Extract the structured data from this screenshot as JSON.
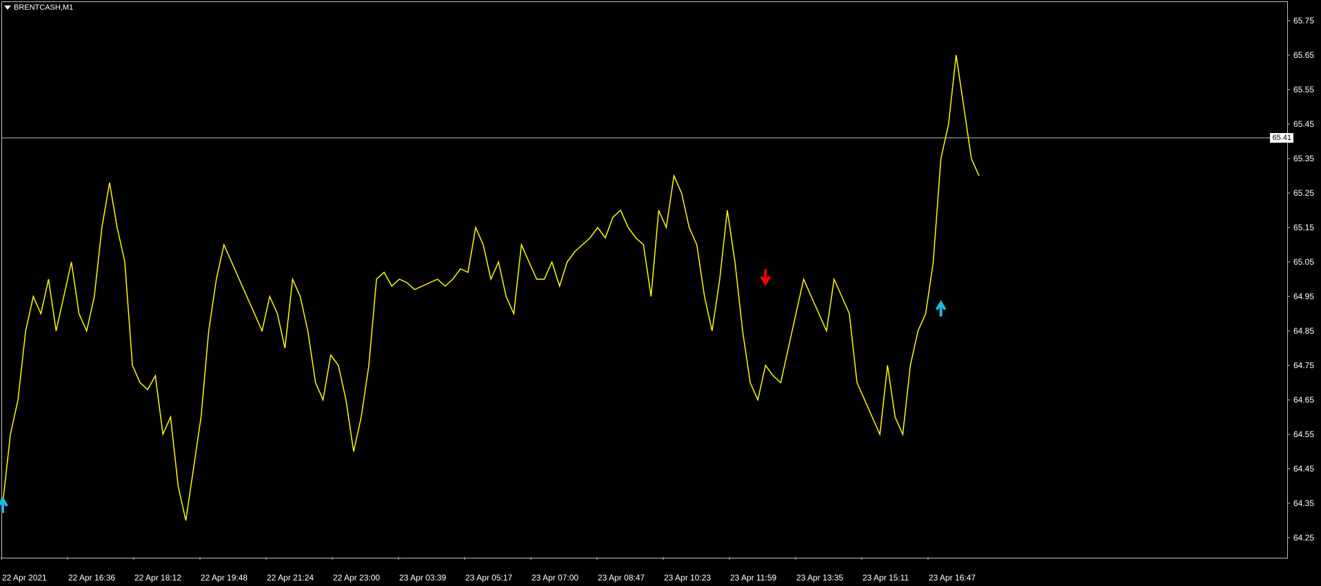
{
  "window": {
    "symbol": "BRENTCASH,M1"
  },
  "price_axis": {
    "ticks": [
      "65.75",
      "65.65",
      "65.55",
      "65.45",
      "65.35",
      "65.25",
      "65.15",
      "65.05",
      "64.95",
      "64.85",
      "64.75",
      "64.65",
      "64.55",
      "64.45",
      "64.35",
      "64.25"
    ],
    "current_price_label": "65.41"
  },
  "time_axis": {
    "ticks": [
      "22 Apr 2021",
      "22 Apr 16:36",
      "22 Apr 18:12",
      "22 Apr 19:48",
      "22 Apr 21:24",
      "22 Apr 23:00",
      "23 Apr 03:39",
      "23 Apr 05:17",
      "23 Apr 07:00",
      "23 Apr 08:47",
      "23 Apr 10:23",
      "23 Apr 11:59",
      "23 Apr 13:35",
      "23 Apr 15:11",
      "23 Apr 16:47"
    ]
  },
  "colors": {
    "background": "#000000",
    "price_line": "#ffff00",
    "grid_frame": "#c0c0c0",
    "current_price_line": "#b0c4de",
    "buy_arrow": "#1fb8e0",
    "sell_arrow": "#ff0000"
  },
  "chart_data": {
    "type": "line",
    "title": "BRENTCASH,M1",
    "ylim": [
      64.2,
      65.8
    ],
    "current_price": 65.41,
    "series": [
      {
        "values": [
          64.35,
          64.55,
          64.65,
          64.85,
          64.95,
          64.9,
          65.0,
          64.85,
          64.95,
          65.05,
          64.9,
          64.85,
          64.95,
          65.15,
          65.28,
          65.15,
          65.05,
          64.75,
          64.7,
          64.68,
          64.72,
          64.55,
          64.6,
          64.4,
          64.3,
          64.45,
          64.6,
          64.85,
          65.0,
          65.1,
          65.05,
          65.0,
          64.95,
          64.9,
          64.85,
          64.95,
          64.9,
          64.8,
          65.0,
          64.95,
          64.85,
          64.7,
          64.65,
          64.78,
          64.75,
          64.65,
          64.5,
          64.6,
          64.75,
          65.0,
          65.02,
          64.98,
          65.0,
          64.99,
          64.97,
          64.98,
          64.99,
          65.0,
          64.98,
          65.0,
          65.03,
          65.02,
          65.15,
          65.1,
          65.0,
          65.05,
          64.95,
          64.9,
          65.1,
          65.05,
          65.0,
          65.0,
          65.05,
          64.98,
          65.05,
          65.08,
          65.1,
          65.12,
          65.15,
          65.12,
          65.18,
          65.2,
          65.15,
          65.12,
          65.1,
          64.95,
          65.2,
          65.15,
          65.3,
          65.25,
          65.15,
          65.1,
          64.95,
          64.85,
          65.0,
          65.2,
          65.05,
          64.85,
          64.7,
          64.65,
          64.75,
          64.72,
          64.7,
          64.8,
          64.9,
          65.0,
          64.95,
          64.9,
          64.85,
          65.0,
          64.95,
          64.9,
          64.7,
          64.65,
          64.6,
          64.55,
          64.75,
          64.6,
          64.55,
          64.75,
          64.85,
          64.9,
          65.05,
          65.35,
          65.45,
          65.65,
          65.5,
          65.35,
          65.3
        ]
      }
    ],
    "signals": [
      {
        "type": "buy",
        "price": 64.35
      },
      {
        "type": "sell",
        "price": 65.0
      },
      {
        "type": "buy",
        "price": 64.92
      }
    ]
  }
}
